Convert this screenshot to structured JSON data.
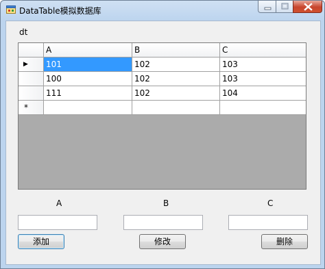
{
  "window": {
    "title": "DataTable模拟数据库"
  },
  "group": {
    "label": "dt"
  },
  "grid": {
    "columns": [
      "A",
      "B",
      "C"
    ],
    "rows": [
      [
        "101",
        "102",
        "103"
      ],
      [
        "100",
        "102",
        "103"
      ],
      [
        "111",
        "102",
        "104"
      ]
    ],
    "current_row_marker": "▶",
    "new_row_marker": "*"
  },
  "form": {
    "labels": {
      "a": "A",
      "b": "B",
      "c": "C"
    },
    "values": {
      "a": "",
      "b": "",
      "c": ""
    }
  },
  "buttons": {
    "add": "添加",
    "edit": "修改",
    "delete": "删除"
  },
  "icons": {
    "app": "form-window-icon",
    "minimize": "minimize-icon",
    "maximize": "maximize-icon",
    "close": "close-icon"
  }
}
